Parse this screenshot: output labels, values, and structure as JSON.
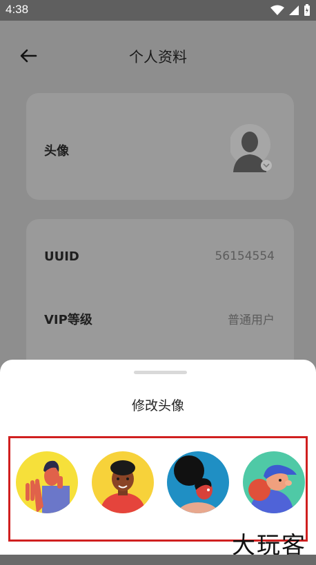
{
  "status_bar": {
    "time": "4:38"
  },
  "header": {
    "title": "个人资料"
  },
  "profile": {
    "avatar_label": "头像",
    "uuid_label": "UUID",
    "uuid_value": "56154554",
    "vip_label": "VIP等级",
    "vip_value": "普通用户"
  },
  "sheet": {
    "title": "修改头像",
    "avatar_options": [
      {
        "icon": "avatar-waving-man"
      },
      {
        "icon": "avatar-curly-hair-man"
      },
      {
        "icon": "avatar-bun-hair-woman"
      },
      {
        "icon": "avatar-cap-boy"
      }
    ]
  },
  "watermark": "大玩客",
  "colors": {
    "highlight": "#d01f1f",
    "overlay": "#8e8e8e"
  }
}
